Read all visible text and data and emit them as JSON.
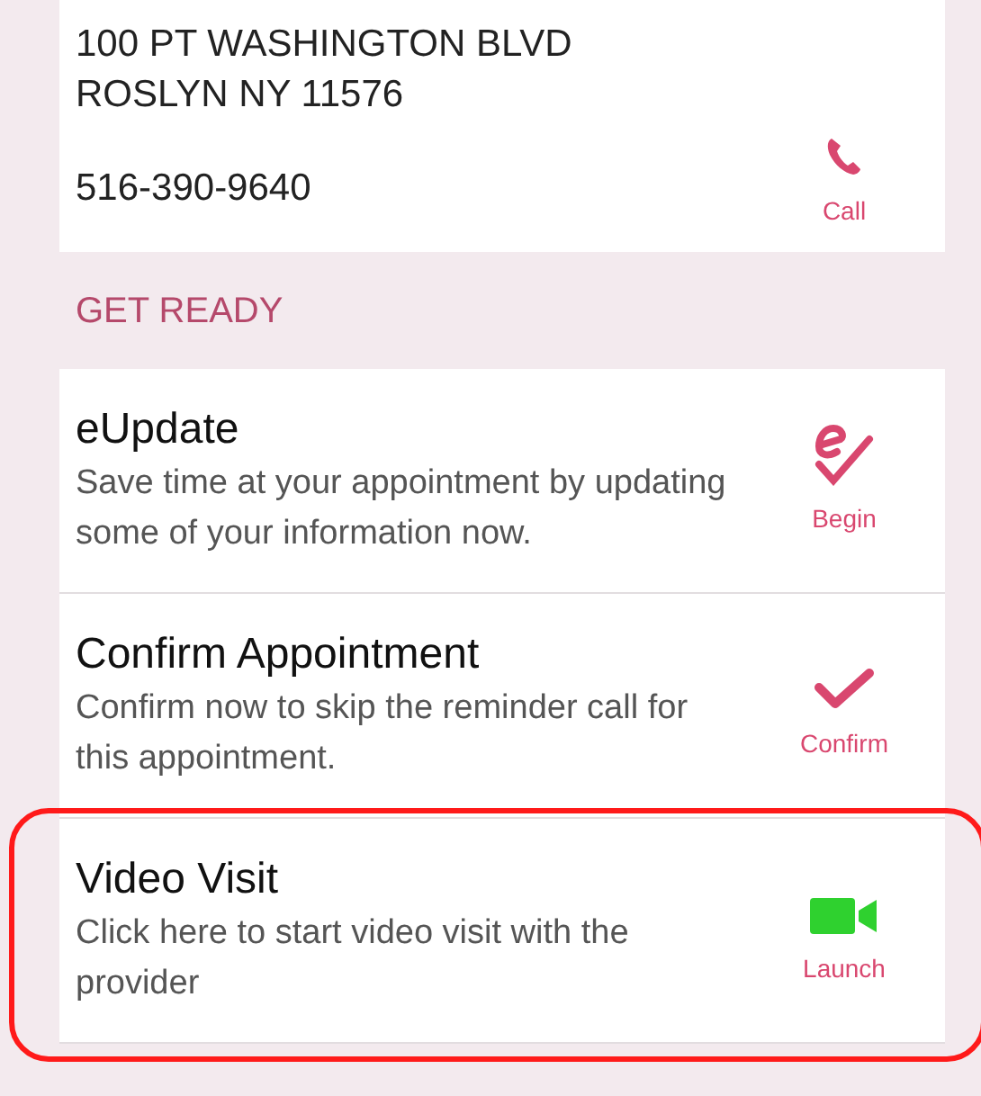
{
  "location": {
    "address_lines": [
      "100 PT WASHINGTON BLVD",
      "ROSLYN NY 11576"
    ],
    "phone": "516-390-9640",
    "action": {
      "kind": "call",
      "label": "Call"
    }
  },
  "section_title": "GET READY",
  "tasks": [
    {
      "title": "eUpdate",
      "description": "Save time at your appointment by updating some of your information now.",
      "action": {
        "kind": "edit",
        "label": "Begin"
      },
      "highlighted": false
    },
    {
      "title": "Confirm Appointment",
      "description": "Confirm now to skip the reminder call for this appointment.",
      "action": {
        "kind": "check",
        "label": "Confirm"
      },
      "highlighted": false
    },
    {
      "title": "Video Visit",
      "description": "Click here to start video visit with the provider",
      "action": {
        "kind": "video",
        "label": "Launch"
      },
      "highlighted": true
    }
  ]
}
